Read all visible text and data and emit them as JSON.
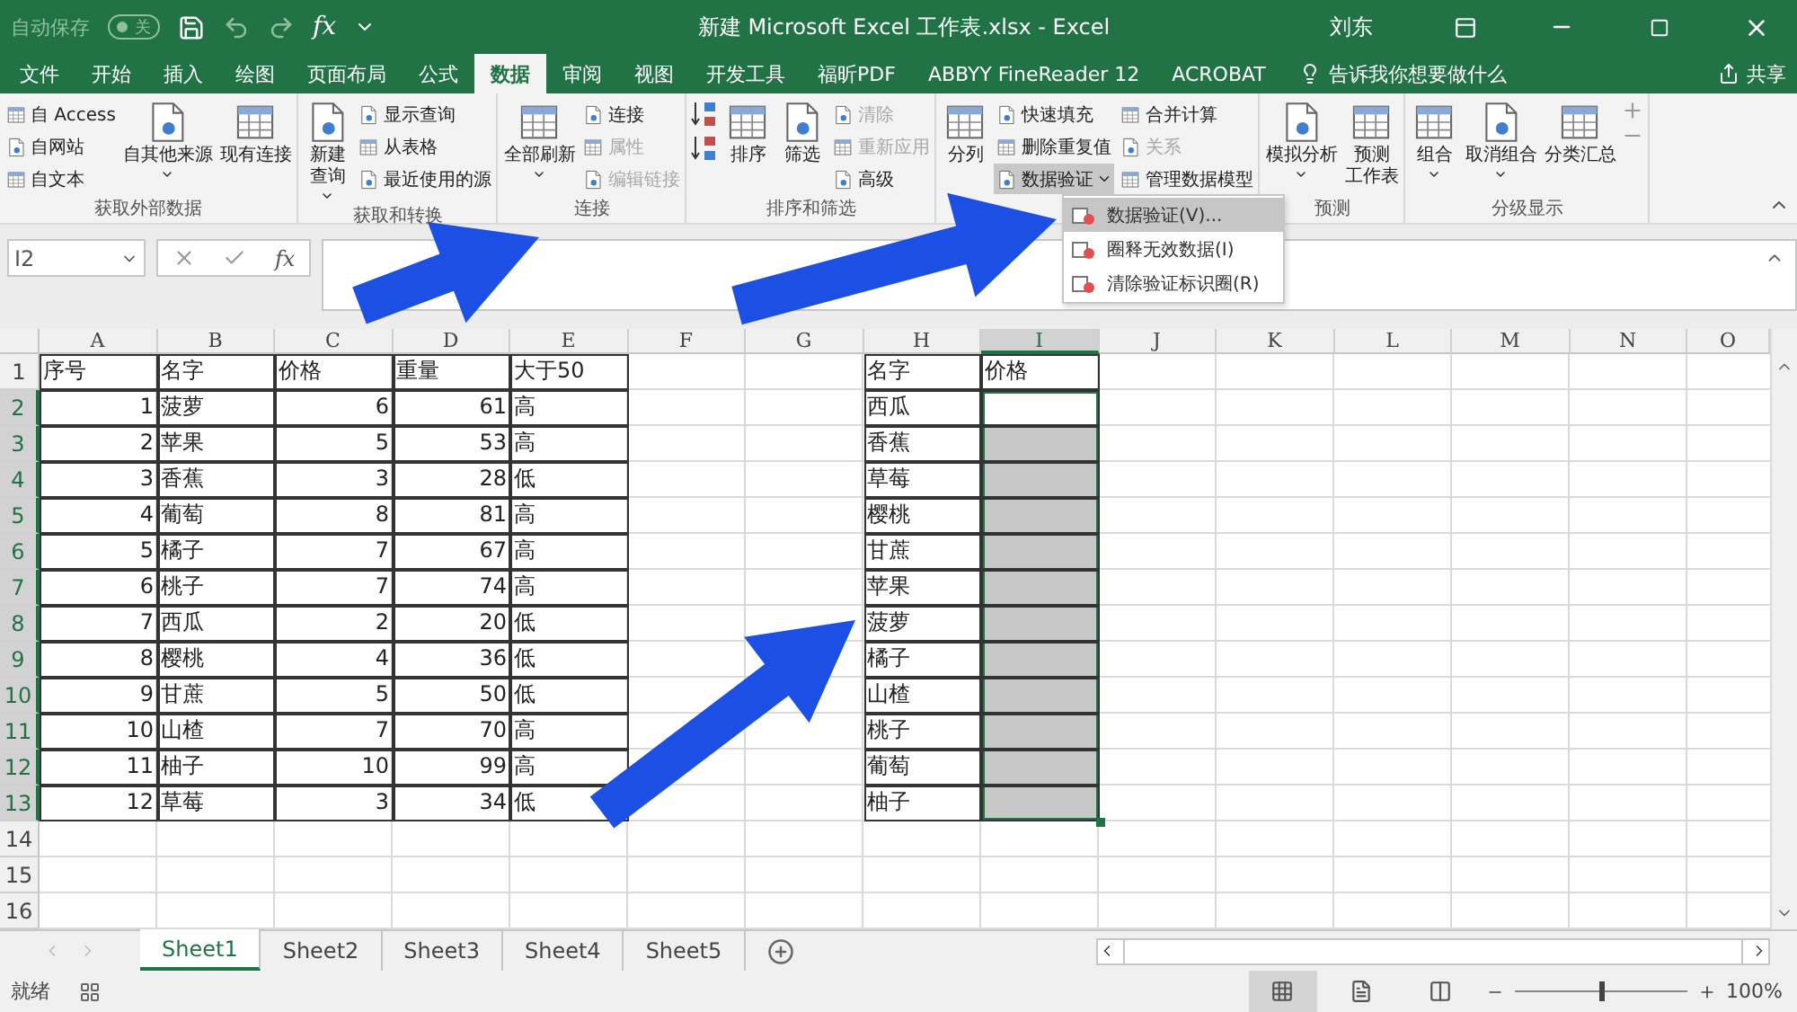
{
  "title_bar": {
    "autosave": {
      "label": "自动保存",
      "on": false,
      "state": "关"
    },
    "formula_glyph": "fx",
    "title": "新建 Microsoft Excel 工作表.xlsx - Excel",
    "user": "刘东"
  },
  "ribbon_tabs": [
    {
      "label": "文件",
      "selected": false
    },
    {
      "label": "开始",
      "selected": false
    },
    {
      "label": "插入",
      "selected": false
    },
    {
      "label": "绘图",
      "selected": false
    },
    {
      "label": "页面布局",
      "selected": false
    },
    {
      "label": "公式",
      "selected": false
    },
    {
      "label": "数据",
      "selected": true
    },
    {
      "label": "审阅",
      "selected": false
    },
    {
      "label": "视图",
      "selected": false
    },
    {
      "label": "开发工具",
      "selected": false
    },
    {
      "label": "福昕PDF",
      "selected": false
    },
    {
      "label": "ABBYY FineReader 12",
      "selected": false
    },
    {
      "label": "ACROBAT",
      "selected": false
    }
  ],
  "tell_me": "告诉我你想要做什么",
  "share": "共享",
  "ribbon_groups": [
    {
      "label": "获取外部数据",
      "parts": [
        {
          "kind": "small_stack",
          "items": [
            {
              "label": "自 Access",
              "disabled": false,
              "pressed": false
            },
            {
              "label": "自网站",
              "disabled": false,
              "pressed": false
            },
            {
              "label": "自文本",
              "disabled": false,
              "pressed": false
            }
          ]
        },
        {
          "kind": "large",
          "lines": [
            "自其他来源"
          ],
          "dropdown": true
        },
        {
          "kind": "large",
          "lines": [
            "现有连接"
          ],
          "dropdown": false
        }
      ]
    },
    {
      "label": "获取和转换",
      "parts": [
        {
          "kind": "large",
          "lines": [
            "新建",
            "查询"
          ],
          "dropdown": true
        },
        {
          "kind": "small_stack",
          "items": [
            {
              "label": "显示查询",
              "disabled": false,
              "pressed": false
            },
            {
              "label": "从表格",
              "disabled": false,
              "pressed": false
            },
            {
              "label": "最近使用的源",
              "disabled": false,
              "pressed": false
            }
          ]
        }
      ]
    },
    {
      "label": "连接",
      "parts": [
        {
          "kind": "large",
          "lines": [
            "全部刷新"
          ],
          "dropdown": true
        },
        {
          "kind": "small_stack",
          "items": [
            {
              "label": "连接",
              "disabled": false,
              "pressed": false
            },
            {
              "label": "属性",
              "disabled": true,
              "pressed": false
            },
            {
              "label": "编辑链接",
              "disabled": true,
              "pressed": false
            }
          ]
        }
      ]
    },
    {
      "label": "排序和筛选",
      "parts": [
        {
          "kind": "sort_icons"
        },
        {
          "kind": "large",
          "lines": [
            "排序"
          ],
          "dropdown": false
        },
        {
          "kind": "large",
          "lines": [
            "筛选"
          ],
          "dropdown": false
        },
        {
          "kind": "small_stack",
          "items": [
            {
              "label": "清除",
              "disabled": true,
              "pressed": false
            },
            {
              "label": "重新应用",
              "disabled": true,
              "pressed": false
            },
            {
              "label": "高级",
              "disabled": false,
              "pressed": false
            }
          ]
        }
      ]
    },
    {
      "parts": [
        {
          "kind": "large",
          "lines": [
            "分列"
          ],
          "dropdown": false
        },
        {
          "kind": "small_stack",
          "items": [
            {
              "label": "快速填充",
              "disabled": false,
              "pressed": false
            },
            {
              "label": "删除重复值",
              "disabled": false,
              "pressed": false
            },
            {
              "label": "数据验证",
              "disabled": false,
              "pressed": true,
              "dropdown": true
            }
          ]
        },
        {
          "kind": "small_stack",
          "items": [
            {
              "label": "合并计算",
              "disabled": false,
              "pressed": false
            },
            {
              "label": "关系",
              "disabled": true,
              "pressed": false
            },
            {
              "label": "管理数据模型",
              "disabled": false,
              "pressed": false
            }
          ]
        }
      ]
    },
    {
      "label": "预测",
      "parts": [
        {
          "kind": "large",
          "lines": [
            "模拟分析"
          ],
          "dropdown": true
        },
        {
          "kind": "large",
          "lines": [
            "预测",
            "工作表"
          ],
          "dropdown": false
        }
      ]
    },
    {
      "label": "分级显示",
      "parts": [
        {
          "kind": "large",
          "lines": [
            "组合"
          ],
          "dropdown": true
        },
        {
          "kind": "large",
          "lines": [
            "取消组合"
          ],
          "dropdown": true
        },
        {
          "kind": "large",
          "lines": [
            "分类汇总"
          ],
          "dropdown": false
        },
        {
          "kind": "outline_icons"
        }
      ]
    }
  ],
  "menu": [
    {
      "label": "数据验证(V)...",
      "selected": true
    },
    {
      "label": "圈释无效数据(I)",
      "selected": false
    },
    {
      "label": "清除验证标识圈(R)",
      "selected": false
    }
  ],
  "formula_bar": {
    "name_box": "I2",
    "fx": "fx"
  },
  "sheet": {
    "columns": [
      {
        "label": "A",
        "selected": false
      },
      {
        "label": "B",
        "selected": false
      },
      {
        "label": "C",
        "selected": false
      },
      {
        "label": "D",
        "selected": false
      },
      {
        "label": "E",
        "selected": false
      },
      {
        "label": "F",
        "selected": false
      },
      {
        "label": "G",
        "selected": false
      },
      {
        "label": "H",
        "selected": false
      },
      {
        "label": "I",
        "selected": true
      },
      {
        "label": "J",
        "selected": false
      },
      {
        "label": "K",
        "selected": false
      },
      {
        "label": "L",
        "selected": false
      },
      {
        "label": "M",
        "selected": false
      },
      {
        "label": "N",
        "selected": false
      },
      {
        "label": "O",
        "selected": false
      }
    ],
    "rows": [
      {
        "label": "1",
        "selected": false
      },
      {
        "label": "2",
        "selected": true
      },
      {
        "label": "3",
        "selected": true
      },
      {
        "label": "4",
        "selected": true
      },
      {
        "label": "5",
        "selected": true
      },
      {
        "label": "6",
        "selected": true
      },
      {
        "label": "7",
        "selected": true
      },
      {
        "label": "8",
        "selected": true
      },
      {
        "label": "9",
        "selected": true
      },
      {
        "label": "10",
        "selected": true
      },
      {
        "label": "11",
        "selected": true
      },
      {
        "label": "12",
        "selected": true
      },
      {
        "label": "13",
        "selected": true
      },
      {
        "label": "14",
        "selected": false
      },
      {
        "label": "15",
        "selected": false
      },
      {
        "label": "16",
        "selected": false
      }
    ],
    "table_1": {
      "header": [
        "序号",
        "名字",
        "价格",
        "重量",
        "大于50"
      ],
      "rows": [
        [
          "1",
          "菠萝",
          "6",
          "61",
          "高"
        ],
        [
          "2",
          "苹果",
          "5",
          "53",
          "高"
        ],
        [
          "3",
          "香蕉",
          "3",
          "28",
          "低"
        ],
        [
          "4",
          "葡萄",
          "8",
          "81",
          "高"
        ],
        [
          "5",
          "橘子",
          "7",
          "67",
          "高"
        ],
        [
          "6",
          "桃子",
          "7",
          "74",
          "高"
        ],
        [
          "7",
          "西瓜",
          "2",
          "20",
          "低"
        ],
        [
          "8",
          "樱桃",
          "4",
          "36",
          "低"
        ],
        [
          "9",
          "甘蔗",
          "5",
          "50",
          "低"
        ],
        [
          "10",
          "山楂",
          "7",
          "70",
          "高"
        ],
        [
          "11",
          "柚子",
          "10",
          "99",
          "高"
        ],
        [
          "12",
          "草莓",
          "3",
          "34",
          "低"
        ]
      ]
    },
    "table_2": {
      "header": [
        "名字",
        "价格"
      ],
      "rows": [
        {
          "name": "西瓜",
          "selected": true,
          "active": true
        },
        {
          "name": "香蕉",
          "selected": true,
          "active": false
        },
        {
          "name": "草莓",
          "selected": true,
          "active": false
        },
        {
          "name": "樱桃",
          "selected": true,
          "active": false
        },
        {
          "name": "甘蔗",
          "selected": true,
          "active": false
        },
        {
          "name": "苹果",
          "selected": true,
          "active": false
        },
        {
          "name": "菠萝",
          "selected": true,
          "active": false
        },
        {
          "name": "橘子",
          "selected": true,
          "active": false
        },
        {
          "name": "山楂",
          "selected": true,
          "active": false
        },
        {
          "name": "桃子",
          "selected": true,
          "active": false
        },
        {
          "name": "葡萄",
          "selected": true,
          "active": false
        },
        {
          "name": "柚子",
          "selected": true,
          "active": false
        }
      ]
    }
  },
  "sheet_tabs": [
    {
      "label": "Sheet1",
      "selected": true
    },
    {
      "label": "Sheet2",
      "selected": false
    },
    {
      "label": "Sheet3",
      "selected": false
    },
    {
      "label": "Sheet4",
      "selected": false
    },
    {
      "label": "Sheet5",
      "selected": false
    }
  ],
  "status_bar": {
    "status": "就绪",
    "views": [
      {
        "selected": true
      },
      {
        "selected": false
      },
      {
        "selected": false
      }
    ],
    "zoom": {
      "level": 0.5,
      "reading": "100%"
    }
  }
}
